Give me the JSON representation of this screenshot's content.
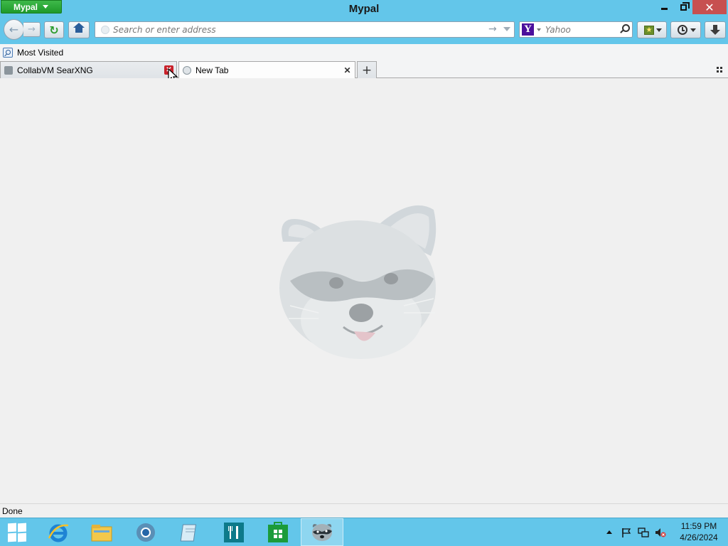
{
  "window": {
    "app_menu_label": "Mypal",
    "title": "Mypal",
    "min_label": "",
    "close_label": "✕"
  },
  "navbar": {
    "back_icon": "back-arrow-icon",
    "forward_icon": "forward-arrow-icon",
    "reload_icon": "reload-icon",
    "home_icon": "home-icon",
    "url": {
      "placeholder": "Search or enter address",
      "value": ""
    },
    "search": {
      "engine": "Yahoo",
      "placeholder": "Yahoo",
      "engine_badge": "Y"
    }
  },
  "bookmarks_toolbar": {
    "items": [
      {
        "label": "Most Visited"
      }
    ]
  },
  "tabs": [
    {
      "label": "CollabVM SearXNG",
      "active": false
    },
    {
      "label": "New Tab",
      "active": true
    }
  ],
  "newtab_label": "+",
  "status_bar": {
    "text": "Done"
  },
  "taskbar": {
    "items": [
      {
        "name": "start"
      },
      {
        "name": "internet-explorer"
      },
      {
        "name": "file-explorer"
      },
      {
        "name": "chrome"
      },
      {
        "name": "notepad"
      },
      {
        "name": "restaurant-app"
      },
      {
        "name": "windows-store"
      },
      {
        "name": "mypal",
        "active": true
      }
    ],
    "clock": {
      "time": "11:59 PM",
      "date": "4/26/2024"
    }
  },
  "colors": {
    "chrome_accent": "#63c6ea",
    "app_menu_green": "#2aa83a",
    "close_red": "#c75050",
    "content_bg": "#f0f0f0"
  }
}
